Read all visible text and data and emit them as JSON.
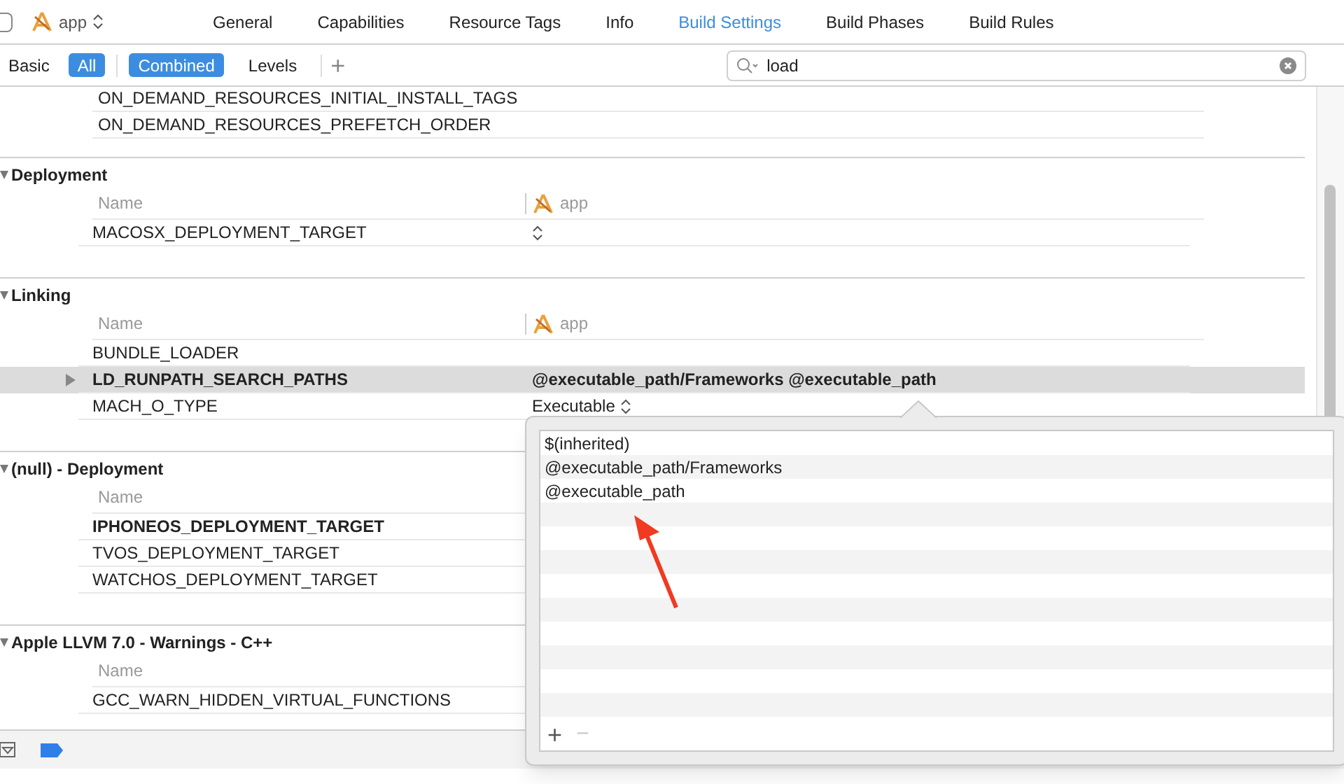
{
  "target": {
    "name": "app"
  },
  "tabs": [
    {
      "label": "General",
      "selected": false
    },
    {
      "label": "Capabilities",
      "selected": false
    },
    {
      "label": "Resource Tags",
      "selected": false
    },
    {
      "label": "Info",
      "selected": false
    },
    {
      "label": "Build Settings",
      "selected": true
    },
    {
      "label": "Build Phases",
      "selected": false
    },
    {
      "label": "Build Rules",
      "selected": false
    }
  ],
  "filters": [
    {
      "label": "Basic",
      "selected": false
    },
    {
      "label": "All",
      "selected": true
    }
  ],
  "views": [
    {
      "label": "Combined",
      "selected": true
    },
    {
      "label": "Levels",
      "selected": false
    }
  ],
  "add_button": "+",
  "search": {
    "value": "load"
  },
  "top_rows": [
    "ON_DEMAND_RESOURCES_INITIAL_INSTALL_TAGS",
    "ON_DEMAND_RESOURCES_PREFETCH_ORDER"
  ],
  "sections": [
    {
      "title": "Deployment",
      "expanded": true,
      "name_header": "Name",
      "target_header": "app",
      "rows": [
        {
          "name": "MACOSX_DEPLOYMENT_TARGET",
          "bold": false,
          "selected": false,
          "kind": "popup",
          "value": ""
        }
      ]
    },
    {
      "title": "Linking",
      "expanded": true,
      "name_header": "Name",
      "target_header": "app",
      "rows": [
        {
          "name": "BUNDLE_LOADER",
          "bold": false,
          "selected": false,
          "kind": "text",
          "value": ""
        },
        {
          "name": "LD_RUNPATH_SEARCH_PATHS",
          "bold": true,
          "selected": true,
          "kind": "list",
          "value": "@executable_path/Frameworks @executable_path"
        },
        {
          "name": "MACH_O_TYPE",
          "bold": false,
          "selected": false,
          "kind": "popup",
          "value": "Executable"
        }
      ]
    },
    {
      "title": "(null) - Deployment",
      "expanded": true,
      "name_header": "Name",
      "rows": [
        {
          "name": "IPHONEOS_DEPLOYMENT_TARGET",
          "bold": true,
          "selected": false,
          "kind": "text",
          "value": ""
        },
        {
          "name": "TVOS_DEPLOYMENT_TARGET",
          "bold": false,
          "selected": false,
          "kind": "text",
          "value": ""
        },
        {
          "name": "WATCHOS_DEPLOYMENT_TARGET",
          "bold": false,
          "selected": false,
          "kind": "text",
          "value": ""
        }
      ]
    },
    {
      "title": "Apple LLVM 7.0 - Warnings - C++",
      "expanded": true,
      "name_header": "Name",
      "rows": [
        {
          "name": "GCC_WARN_HIDDEN_VIRTUAL_FUNCTIONS",
          "bold": false,
          "selected": false,
          "kind": "text",
          "value": ""
        }
      ]
    }
  ],
  "popover": {
    "items": [
      "$(inherited)",
      "@executable_path/Frameworks",
      "@executable_path"
    ],
    "add": "+",
    "remove": "−"
  }
}
